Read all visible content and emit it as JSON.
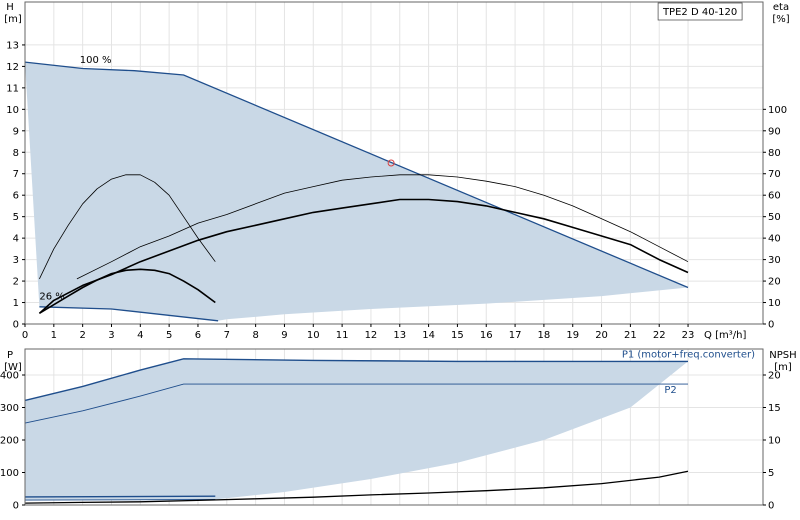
{
  "colors": {
    "envelope_fill": "#c9d8e6",
    "envelope_line": "#1f4e8c",
    "curve": "#000000",
    "duty_point": "#d94040",
    "frame": "#666666"
  },
  "chart_data": [
    {
      "type": "line",
      "title": "",
      "badge": "TPE2 D 40-120",
      "xlabel": "Q [m³/h]",
      "ylabel_text": "H",
      "ylabel_unit": "[m]",
      "y2label_text": "eta",
      "y2label_unit": "[%]",
      "x_ticks": [
        0,
        1,
        2,
        3,
        4,
        5,
        6,
        7,
        8,
        9,
        10,
        11,
        12,
        13,
        14,
        15,
        16,
        17,
        18,
        19,
        20,
        21,
        22,
        23
      ],
      "y_ticks": [
        0,
        1,
        2,
        3,
        4,
        5,
        6,
        7,
        8,
        9,
        10,
        11,
        12,
        13
      ],
      "y2_ticks": [
        0,
        10,
        20,
        30,
        40,
        50,
        60,
        70,
        80,
        90,
        100
      ],
      "xlim": [
        0,
        25.6
      ],
      "ylim": [
        0,
        15
      ],
      "y2lim": [
        0,
        150
      ],
      "grid": true,
      "annotations": [
        {
          "text": "100 %",
          "x": 1.9,
          "y": 12.15
        },
        {
          "text": "26 %",
          "x": 0.5,
          "y": 1.15
        }
      ],
      "envelope": [
        [
          0,
          12.2
        ],
        [
          2,
          11.9
        ],
        [
          3.8,
          11.8
        ],
        [
          5.5,
          11.6
        ],
        [
          23,
          1.7
        ],
        [
          20,
          1.3
        ],
        [
          16,
          0.95
        ],
        [
          12,
          0.7
        ],
        [
          9,
          0.45
        ],
        [
          7,
          0.22
        ],
        [
          6.7,
          0.15
        ],
        [
          3,
          0.7
        ],
        [
          0.5,
          0.8
        ]
      ],
      "duty_point": {
        "x": 12.7,
        "y": 7.5
      },
      "series": [
        {
          "role": "eta_100",
          "axis": "y2",
          "width": 0.8,
          "x": [
            1.8,
            3,
            4,
            5,
            6,
            7,
            8,
            9,
            10,
            11,
            12,
            13,
            14,
            15,
            16,
            17,
            18,
            19,
            20,
            21,
            22,
            23
          ],
          "y": [
            21,
            29,
            36,
            41,
            47,
            51,
            56,
            61,
            64,
            67,
            68.5,
            69.5,
            69.5,
            68.5,
            66.5,
            64,
            60,
            55,
            49,
            43,
            36,
            29
          ]
        },
        {
          "role": "eta_26",
          "axis": "y2",
          "width": 0.8,
          "x": [
            0.5,
            1,
            1.5,
            2,
            2.5,
            3,
            3.5,
            4,
            4.5,
            5,
            5.5,
            6,
            6.6
          ],
          "y": [
            21,
            35,
            46,
            56,
            63,
            67.5,
            69.5,
            69.5,
            66,
            60,
            50,
            40,
            29
          ]
        },
        {
          "role": "head_eta_100",
          "axis": "y2",
          "width": 1.6,
          "x": [
            0.5,
            1,
            2,
            3,
            4,
            5,
            6,
            7,
            8,
            9,
            10,
            11,
            12,
            13,
            14,
            15,
            16,
            17,
            18,
            19,
            20,
            21,
            22,
            23
          ],
          "y": [
            5,
            11,
            18,
            23,
            29,
            34,
            39,
            43,
            46,
            49,
            52,
            54,
            56,
            58,
            58,
            57,
            55,
            52,
            49,
            45,
            41,
            37,
            30,
            24
          ]
        },
        {
          "role": "head_eta_26",
          "axis": "y2",
          "width": 1.6,
          "x": [
            0.5,
            1,
            1.5,
            2,
            2.5,
            3,
            3.5,
            4,
            4.5,
            5,
            5.5,
            6,
            6.6
          ],
          "y": [
            5,
            9,
            13,
            17,
            20.5,
            23.5,
            25,
            25.5,
            25,
            23.5,
            20,
            16,
            10
          ]
        }
      ]
    },
    {
      "type": "line",
      "title": "",
      "ylabel_text": "P",
      "ylabel_unit": "[W]",
      "y2label_text": "NPSH",
      "y2label_unit": "[m]",
      "y_ticks": [
        0,
        100,
        200,
        300,
        400
      ],
      "y2_ticks": [
        0,
        5,
        10,
        15,
        20
      ],
      "ylim": [
        0,
        480
      ],
      "y2lim": [
        0,
        24
      ],
      "grid": true,
      "envelope": [
        [
          0,
          320
        ],
        [
          2,
          365
        ],
        [
          4,
          415
        ],
        [
          5.5,
          448
        ],
        [
          23,
          442
        ],
        [
          21,
          300
        ],
        [
          18,
          200
        ],
        [
          15,
          130
        ],
        [
          12,
          80
        ],
        [
          9,
          40
        ],
        [
          6.7,
          18
        ],
        [
          0,
          15
        ]
      ],
      "series": [
        {
          "role": "P1_100",
          "name": "P1 (motor+freq.converter)",
          "axis": "y",
          "color": "#1f4e8c",
          "width": 1.4,
          "x": [
            0,
            2,
            4,
            5.5,
            10,
            15,
            23
          ],
          "y": [
            322,
            365,
            415,
            450,
            445,
            442,
            442
          ]
        },
        {
          "role": "P2_100",
          "name": "P2",
          "axis": "y",
          "color": "#1f4e8c",
          "width": 0.9,
          "x": [
            0,
            2,
            4,
            5.5,
            10,
            15,
            23
          ],
          "y": [
            252,
            290,
            335,
            372,
            372,
            372,
            372
          ]
        },
        {
          "role": "P1_26",
          "axis": "y",
          "color": "#1f4e8c",
          "width": 1.4,
          "x": [
            0,
            6.6
          ],
          "y": [
            25,
            27
          ]
        },
        {
          "role": "P2_26",
          "axis": "y",
          "color": "#1f4e8c",
          "width": 0.9,
          "x": [
            0,
            6.6
          ],
          "y": [
            15,
            17
          ]
        },
        {
          "role": "npsh",
          "axis": "y2",
          "color": "#000000",
          "width": 1.3,
          "x": [
            0,
            2,
            4,
            6,
            8,
            10,
            12,
            14,
            16,
            18,
            20,
            22,
            23
          ],
          "y": [
            0.3,
            0.4,
            0.5,
            0.7,
            0.95,
            1.2,
            1.55,
            1.85,
            2.2,
            2.65,
            3.3,
            4.3,
            5.2
          ]
        }
      ]
    }
  ]
}
